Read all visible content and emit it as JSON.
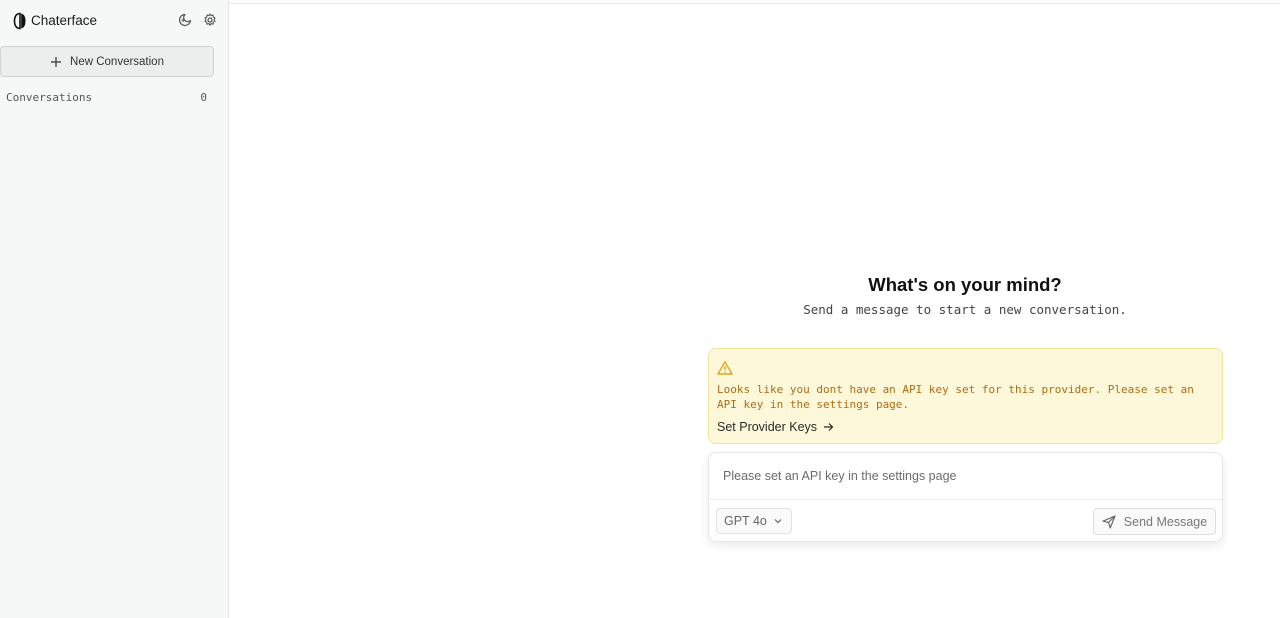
{
  "sidebar": {
    "app_title": "Chaterface",
    "new_conversation_label": "New Conversation",
    "conversations_label": "Conversations",
    "conversations_count": "0",
    "icons": {
      "logo": "chaterface-logo",
      "theme": "moon-icon",
      "settings": "gear-icon",
      "new": "plus-icon"
    }
  },
  "main": {
    "heading": "What's on your mind?",
    "subheading": "Send a message to start a new conversation."
  },
  "warning": {
    "message": "Looks like you dont have an API key set for this provider. Please set an API key in the settings page.",
    "link_label": "Set Provider Keys",
    "icons": {
      "alert": "warning-icon",
      "arrow": "arrow-right-icon"
    }
  },
  "composer": {
    "placeholder": "Please set an API key in the settings page",
    "model": "GPT 4o",
    "send_label": "Send Message",
    "icons": {
      "chevron": "chevron-down-icon",
      "send": "send-icon"
    }
  },
  "colors": {
    "sidebar_bg": "#f6f7f7",
    "warning_bg": "#fdf8d9",
    "warning_border": "#f4e49a",
    "warning_text": "#b06c12",
    "warning_icon": "#e0a81a"
  }
}
